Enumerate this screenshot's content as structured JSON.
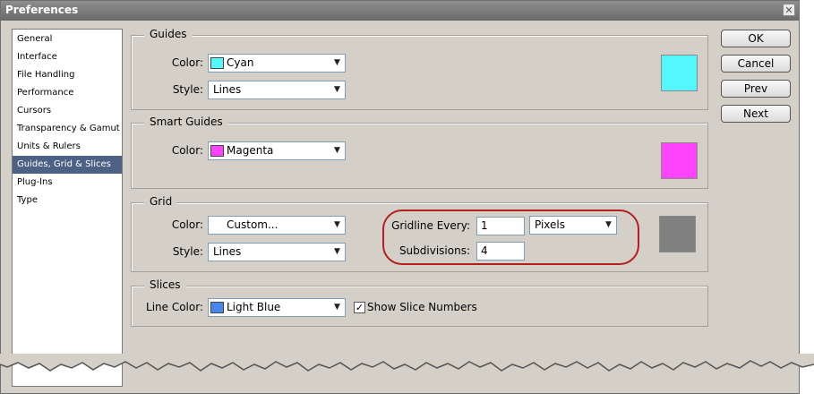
{
  "window": {
    "title": "Preferences"
  },
  "sidebar": {
    "items": [
      {
        "label": "General"
      },
      {
        "label": "Interface"
      },
      {
        "label": "File Handling"
      },
      {
        "label": "Performance"
      },
      {
        "label": "Cursors"
      },
      {
        "label": "Transparency & Gamut"
      },
      {
        "label": "Units & Rulers"
      },
      {
        "label": "Guides, Grid & Slices",
        "selected": true
      },
      {
        "label": "Plug-Ins"
      },
      {
        "label": "Type"
      }
    ]
  },
  "guides": {
    "legend": "Guides",
    "color_label": "Color:",
    "color_value": "Cyan",
    "color_hex": "#55f7ff",
    "style_label": "Style:",
    "style_value": "Lines"
  },
  "smart_guides": {
    "legend": "Smart Guides",
    "color_label": "Color:",
    "color_value": "Magenta",
    "color_hex": "#ff44ff"
  },
  "grid": {
    "legend": "Grid",
    "color_label": "Color:",
    "color_value": "Custom...",
    "color_hex": "#808080",
    "style_label": "Style:",
    "style_value": "Lines",
    "gridline_label": "Gridline Every:",
    "gridline_value": "1",
    "unit_value": "Pixels",
    "subdivisions_label": "Subdivisions:",
    "subdivisions_value": "4"
  },
  "slices": {
    "legend": "Slices",
    "line_color_label": "Line Color:",
    "line_color_value": "Light Blue",
    "line_color_hex": "#4a86ec",
    "show_numbers_label": "Show Slice Numbers",
    "show_numbers_checked": true
  },
  "buttons": {
    "ok": "OK",
    "cancel": "Cancel",
    "prev": "Prev",
    "next": "Next"
  }
}
